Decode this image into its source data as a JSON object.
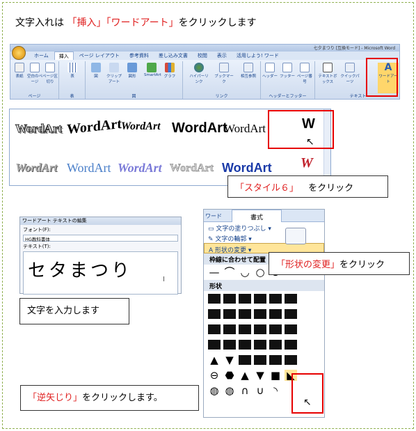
{
  "intro": {
    "text_a": "文字入れは",
    "text_b": "「挿入」「ワードアート」",
    "text_c": "をクリックします"
  },
  "ribbon": {
    "title": "七夕まつり [互換モード] - Microsoft Word",
    "tabs": [
      "ホーム",
      "挿入",
      "ページ レイアウト",
      "参考資料",
      "差し込み文書",
      "校閲",
      "表示",
      "活用しよう! ワード"
    ],
    "groups": [
      "ページ",
      "表",
      "図",
      "リンク",
      "ヘッダーとフッター",
      "テキスト"
    ],
    "buttons": [
      "表紙",
      "空白のページ",
      "ページ区切り",
      "表",
      "図",
      "クリップアート",
      "図形",
      "SmartArt",
      "グラフ",
      "ハイパーリンク",
      "ブックマーク",
      "相互参照",
      "ヘッダー",
      "フッター",
      "ページ番号",
      "テキストボックス",
      "クイックパーツ",
      "ワードアート"
    ]
  },
  "gallery": {
    "row1": [
      "WordArt",
      "WordArt",
      "WordArt",
      "WordArt",
      "WordArt"
    ],
    "row2": [
      "WordArt",
      "WordArt",
      "WordArt",
      "WordArt",
      "WordArt"
    ],
    "style6_top": "W",
    "style6_bottom": "W"
  },
  "callouts": {
    "style6_a": "「スタイル６」",
    "style6_b": "をクリック",
    "input": "文字を入力します",
    "shape_change_a": "「形状の変更」",
    "shape_change_b": "をクリック",
    "gyaku_a": "「逆矢じり」",
    "gyaku_b": "をクリックします。"
  },
  "dialog": {
    "title": "ワードアート テキストの編集",
    "font_label": "フォント(F):",
    "font_value": "HG教科書体",
    "text_label": "テキスト(T):",
    "text_value": "セタまつり"
  },
  "menu": {
    "tab_a": "ワード",
    "tab_b": "書式",
    "fill": "文字の塗りつぶし",
    "outline": "文字の輪郭",
    "change": "形状の変更",
    "section1": "枠線に合わせて配置",
    "section2": "形状"
  }
}
